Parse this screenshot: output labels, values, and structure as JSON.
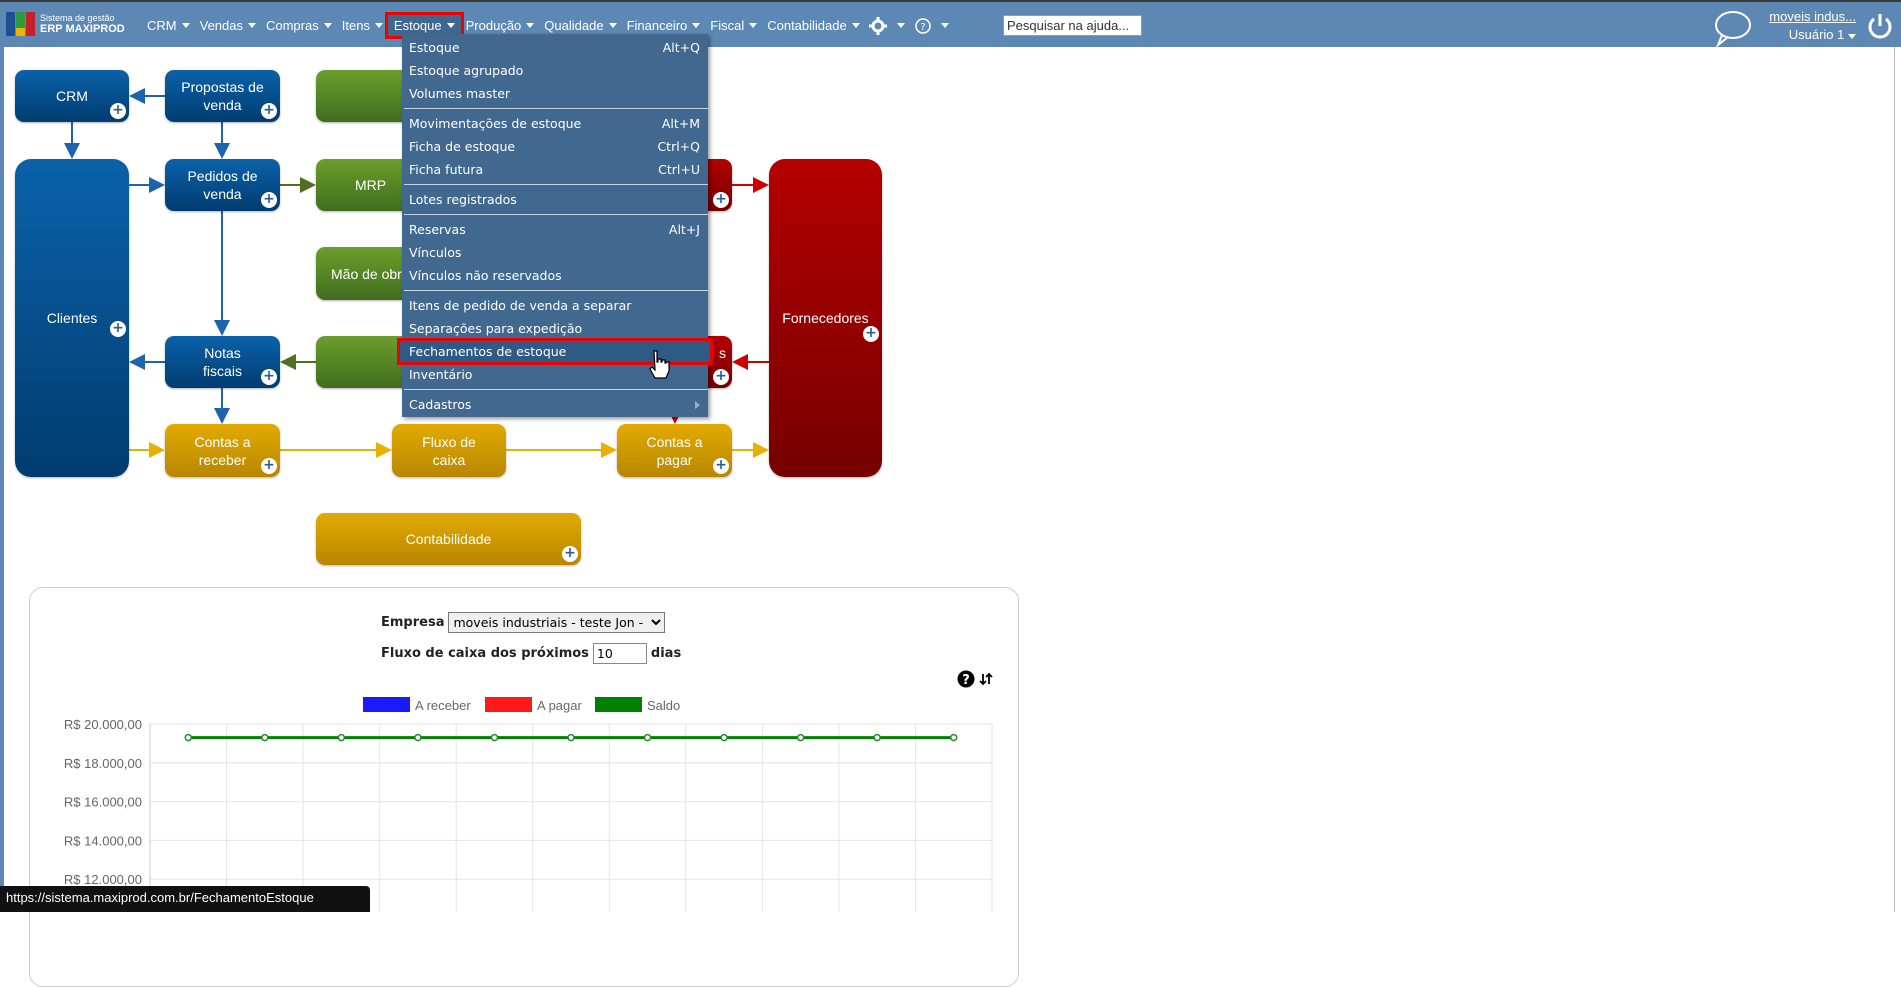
{
  "logo": {
    "line1": "Sistema de gestão",
    "line2": "ERP MAXIPROD"
  },
  "nav": [
    {
      "label": "CRM"
    },
    {
      "label": "Vendas"
    },
    {
      "label": "Compras"
    },
    {
      "label": "Itens"
    },
    {
      "label": "Estoque",
      "active": true
    },
    {
      "label": "Produção"
    },
    {
      "label": "Qualidade"
    },
    {
      "label": "Financeiro"
    },
    {
      "label": "Fiscal"
    },
    {
      "label": "Contabilidade"
    }
  ],
  "search": {
    "placeholder": "Pesquisar na ajuda..."
  },
  "user": {
    "company": "moveis indus...",
    "name": "Usuário 1"
  },
  "menu": [
    {
      "label": "Estoque",
      "shortcut": "Alt+Q"
    },
    {
      "label": "Estoque agrupado",
      "shortcut": ""
    },
    {
      "label": "Volumes master",
      "shortcut": ""
    },
    {
      "sep": true
    },
    {
      "label": "Movimentações de estoque",
      "shortcut": "Alt+M"
    },
    {
      "label": "Ficha de estoque",
      "shortcut": "Ctrl+Q"
    },
    {
      "label": "Ficha futura",
      "shortcut": "Ctrl+U"
    },
    {
      "sep": true
    },
    {
      "label": "Lotes registrados",
      "shortcut": ""
    },
    {
      "sep": true
    },
    {
      "label": "Reservas",
      "shortcut": "Alt+J"
    },
    {
      "label": "Vínculos",
      "shortcut": ""
    },
    {
      "label": "Vínculos não reservados",
      "shortcut": ""
    },
    {
      "sep": true
    },
    {
      "label": "Itens de pedido de venda a separar",
      "shortcut": ""
    },
    {
      "label": "Separações para expedição",
      "shortcut": ""
    },
    {
      "label": "Fechamentos de estoque",
      "shortcut": "",
      "highlighted": true
    },
    {
      "label": "Inventário",
      "shortcut": ""
    },
    {
      "sep": true
    },
    {
      "label": "Cadastros",
      "shortcut": "",
      "submenu": true
    }
  ],
  "diagram": {
    "crm": "CRM",
    "propostas": "Propostas de venda",
    "clientes": "Clientes",
    "pedidos": "Pedidos de venda",
    "mrp": "MRP",
    "mao_obra": "Mão de obra",
    "notas": "Notas fiscais",
    "contas_receber": "Contas a receber",
    "fluxo": "Fluxo de caixa",
    "contas_pagar": "Contas a pagar",
    "fornecedores": "Fornecedores",
    "contabilidade": "Contabilidade",
    "red_bottom_suffix": "s"
  },
  "cashflow": {
    "empresa_label": "Empresa",
    "empresa_value": "moveis industriais - teste Jon -",
    "fluxo_label": "Fluxo de caixa dos próximos",
    "dias_value": "10",
    "dias_label": "dias"
  },
  "chart_data": {
    "type": "line",
    "series": [
      {
        "name": "A receber",
        "color": "#1a1aff",
        "values": []
      },
      {
        "name": "A pagar",
        "color": "#ff1a1a",
        "values": []
      },
      {
        "name": "Saldo",
        "color": "#008000",
        "values": [
          19300,
          19300,
          19300,
          19300,
          19300,
          19300,
          19300,
          19300,
          19300,
          19300,
          19300
        ]
      }
    ],
    "ylim": [
      0,
      20000
    ],
    "yticks": [
      "R$ 20.000,00",
      "R$ 18.000,00",
      "R$ 16.000,00",
      "R$ 14.000,00",
      "R$ 12.000,00"
    ],
    "ytick_values": [
      20000,
      18000,
      16000,
      14000,
      12000
    ],
    "legend": "top-center",
    "grid": true
  },
  "status_url": "https://sistema.maxiprod.com.br/FechamentoEstoque"
}
